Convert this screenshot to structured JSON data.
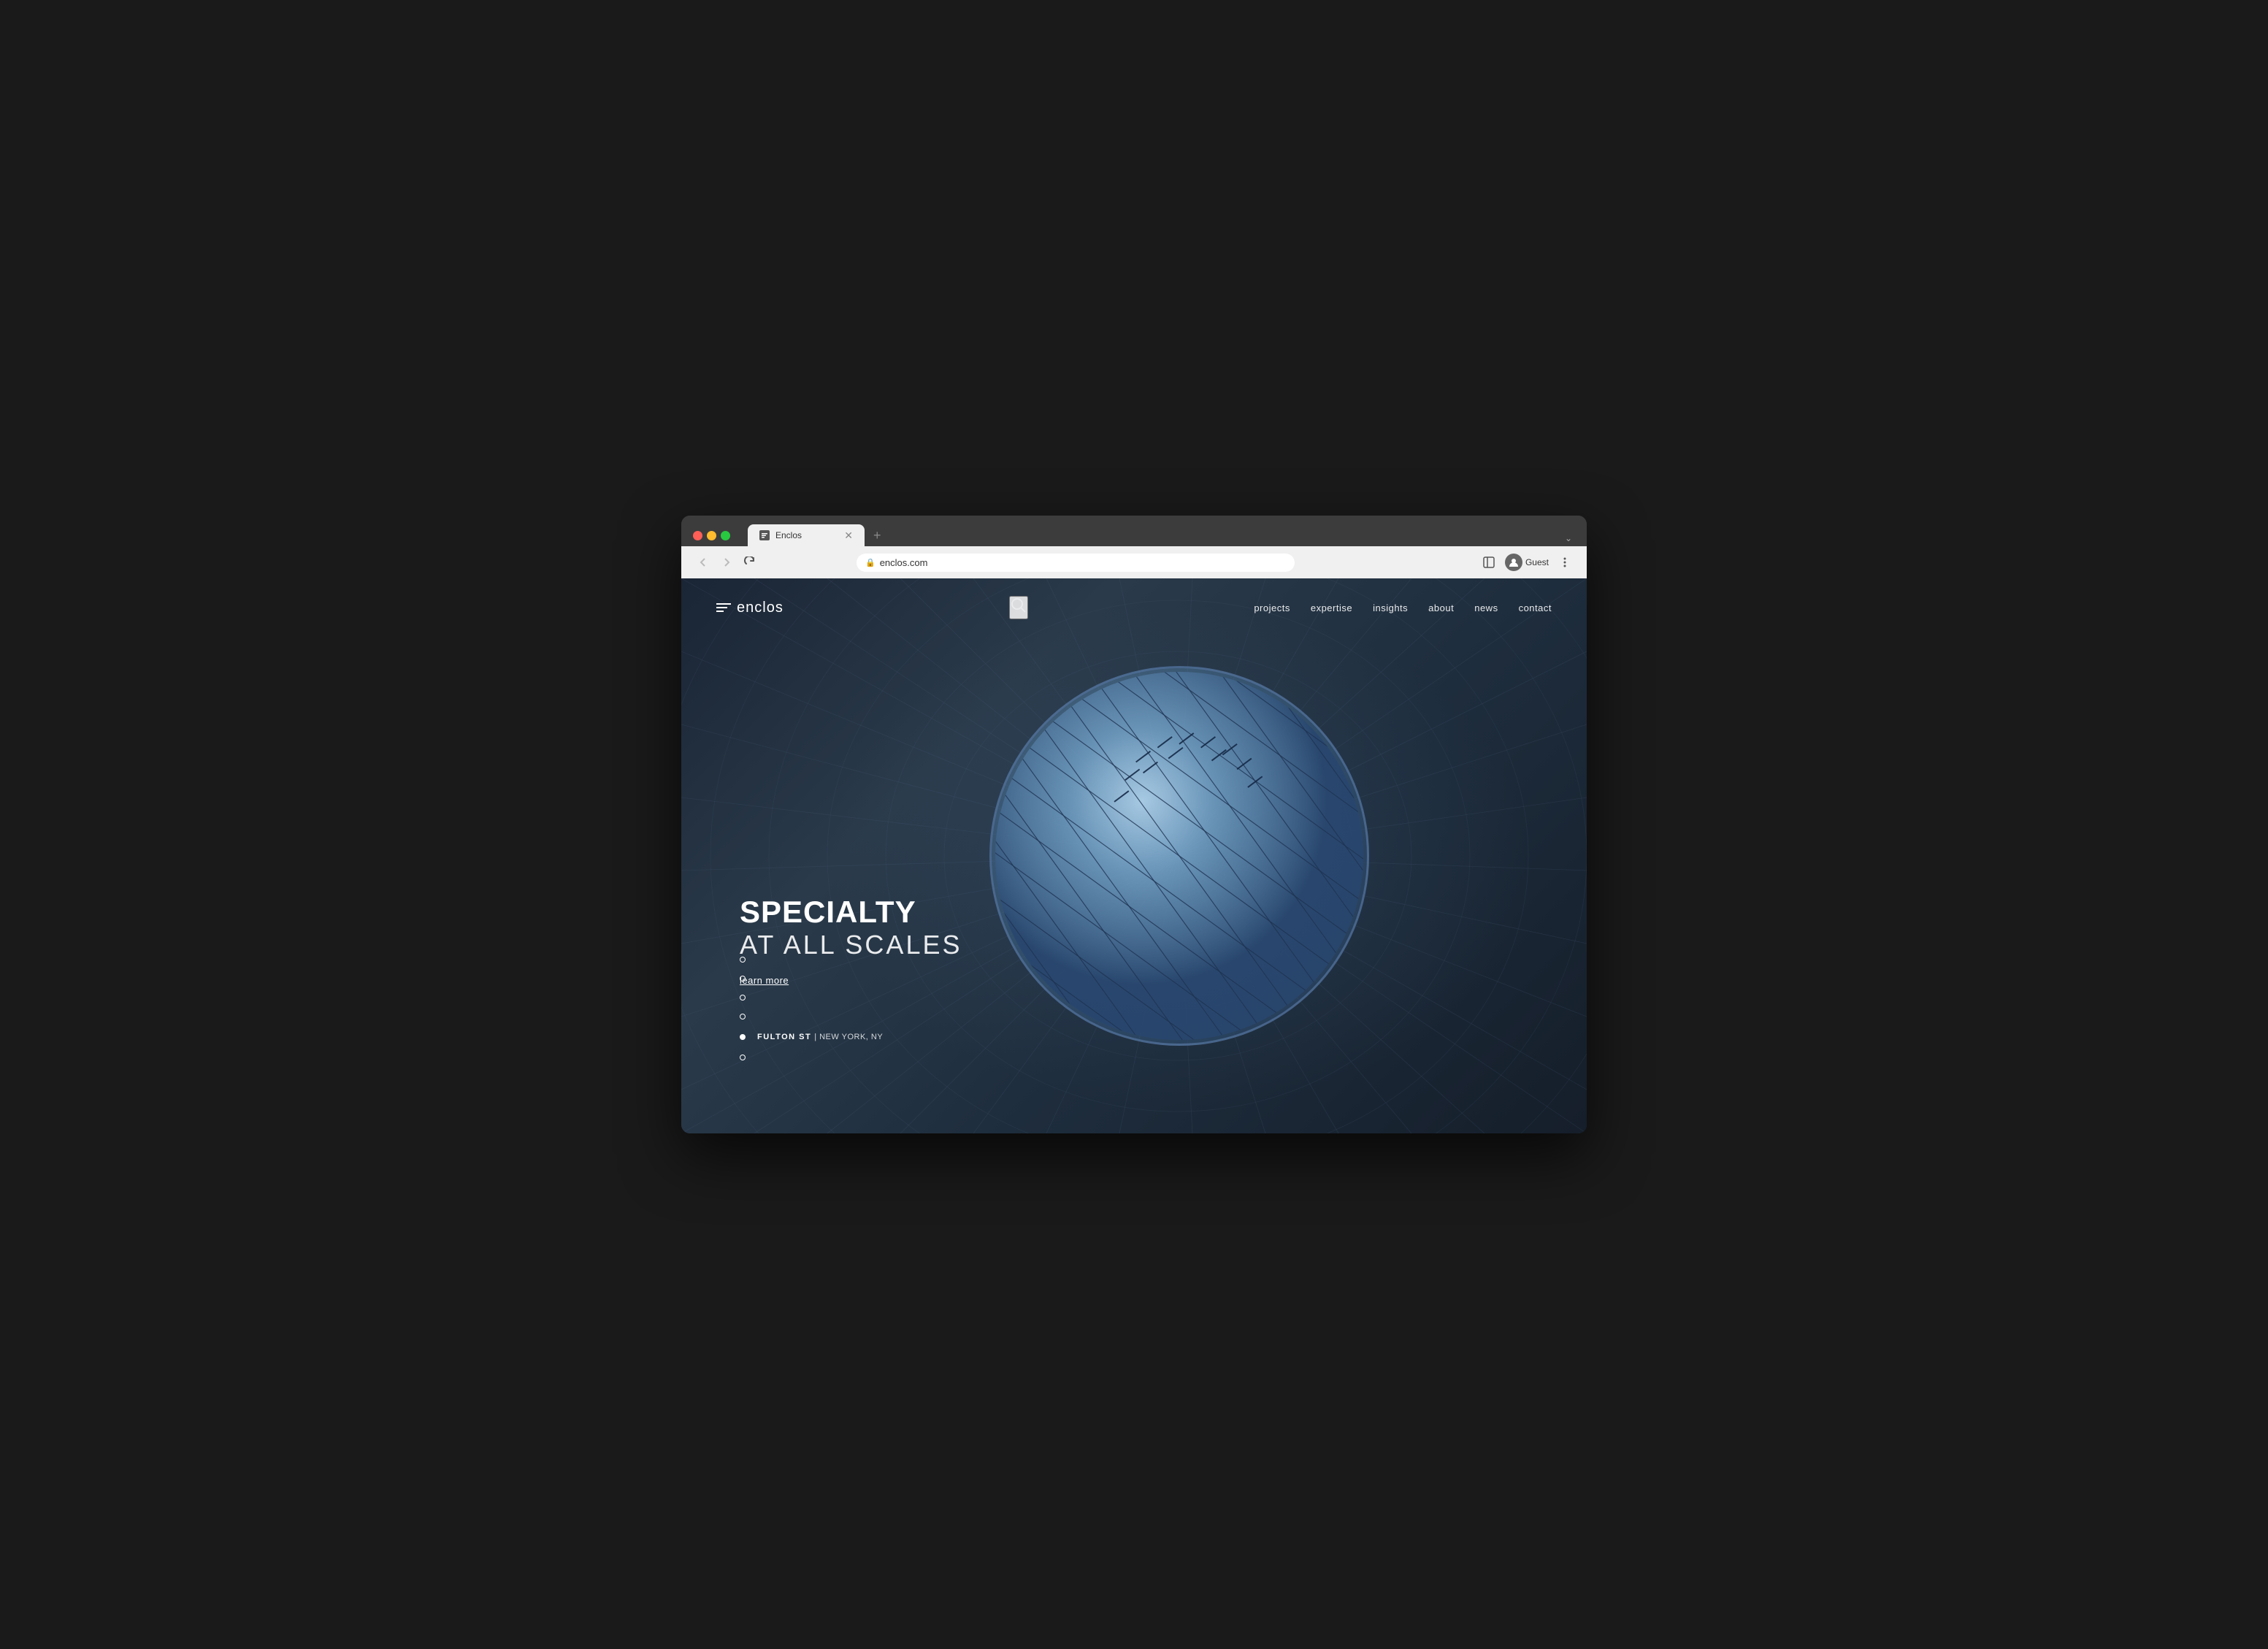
{
  "browser": {
    "tab_title": "Enclos",
    "url": "enclos.com",
    "new_tab_label": "+",
    "user_label": "Guest"
  },
  "nav": {
    "back_label": "←",
    "forward_label": "→",
    "refresh_label": "↻"
  },
  "logo": {
    "text": "enclos"
  },
  "nav_items": [
    {
      "label": "projects",
      "key": "projects"
    },
    {
      "label": "expertise",
      "key": "expertise"
    },
    {
      "label": "insights",
      "key": "insights"
    },
    {
      "label": "about",
      "key": "about"
    },
    {
      "label": "news",
      "key": "news"
    },
    {
      "label": "contact",
      "key": "contact"
    }
  ],
  "hero": {
    "title_bold": "SPECIALTY",
    "title_light": "AT ALL SCALES",
    "learn_more": "learn more"
  },
  "slides": [
    {
      "active": false,
      "index": 0
    },
    {
      "active": false,
      "index": 1
    },
    {
      "active": false,
      "index": 2
    },
    {
      "active": false,
      "index": 3
    },
    {
      "active": true,
      "index": 4,
      "label": "FULTON ST",
      "sublabel": "| NEW YORK, NY"
    },
    {
      "active": false,
      "index": 5
    }
  ]
}
